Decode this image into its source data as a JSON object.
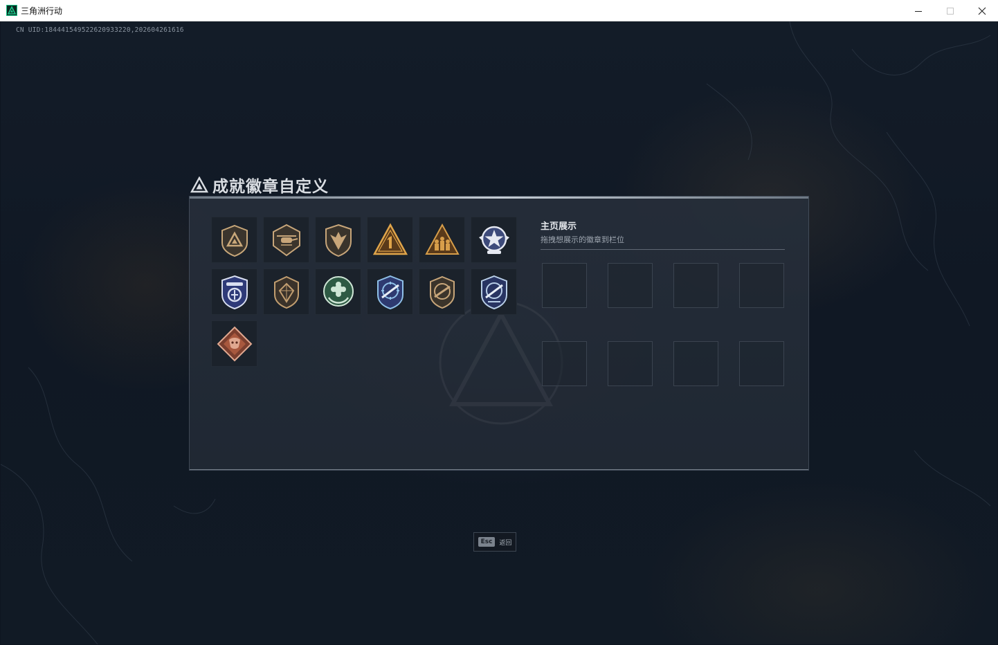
{
  "window": {
    "title": "三角洲行动",
    "minimize_symbol": "—",
    "maximize_symbol": "☐",
    "close_symbol": "✕"
  },
  "game": {
    "uid_text": "CN UID:1844415495226209332​20,202604261616"
  },
  "panel": {
    "title": "成就徽章自定义",
    "showcase": {
      "title": "主页展示",
      "subtitle": "拖拽想展示的徽章到栏位",
      "slot_count": 8
    }
  },
  "badges": [
    {
      "name": "delta-triangle-shield-badge",
      "colors": [
        "#3b352d",
        "#c9a87a"
      ]
    },
    {
      "name": "helicopter-badge",
      "colors": [
        "#3a342c",
        "#c8a67a"
      ]
    },
    {
      "name": "arrowhead-shield-badge",
      "colors": [
        "#3a342c",
        "#c8a67a"
      ]
    },
    {
      "name": "number-one-triangle-badge",
      "colors": [
        "#5a3a1a",
        "#e0a54a"
      ]
    },
    {
      "name": "soldiers-triangle-badge",
      "colors": [
        "#5a3a1a",
        "#d79e4a"
      ]
    },
    {
      "name": "star-wings-badge",
      "colors": [
        "#3d4a7a",
        "#e6e9f2"
      ]
    },
    {
      "name": "police-shield-badge",
      "colors": [
        "#2e3a78",
        "#d9dff0"
      ]
    },
    {
      "name": "gem-shield-badge",
      "colors": [
        "#3a322a",
        "#c29e70"
      ]
    },
    {
      "name": "flower-laurel-badge",
      "colors": [
        "#2e5a44",
        "#cfe6d6"
      ]
    },
    {
      "name": "rifle-crosshair-badge-blue",
      "colors": [
        "#2e3a70",
        "#8fc0e8"
      ]
    },
    {
      "name": "rifle-crosshair-badge-bronze",
      "colors": [
        "#3b342b",
        "#c8a67a"
      ]
    },
    {
      "name": "rifle-crosshair-badge-navy",
      "colors": [
        "#283462",
        "#b9cfe8"
      ]
    },
    {
      "name": "dragon-diamond-badge",
      "colors": [
        "#7a3e2e",
        "#e0a890"
      ]
    }
  ],
  "footer": {
    "esc_key": "Esc",
    "esc_label": "返回"
  }
}
